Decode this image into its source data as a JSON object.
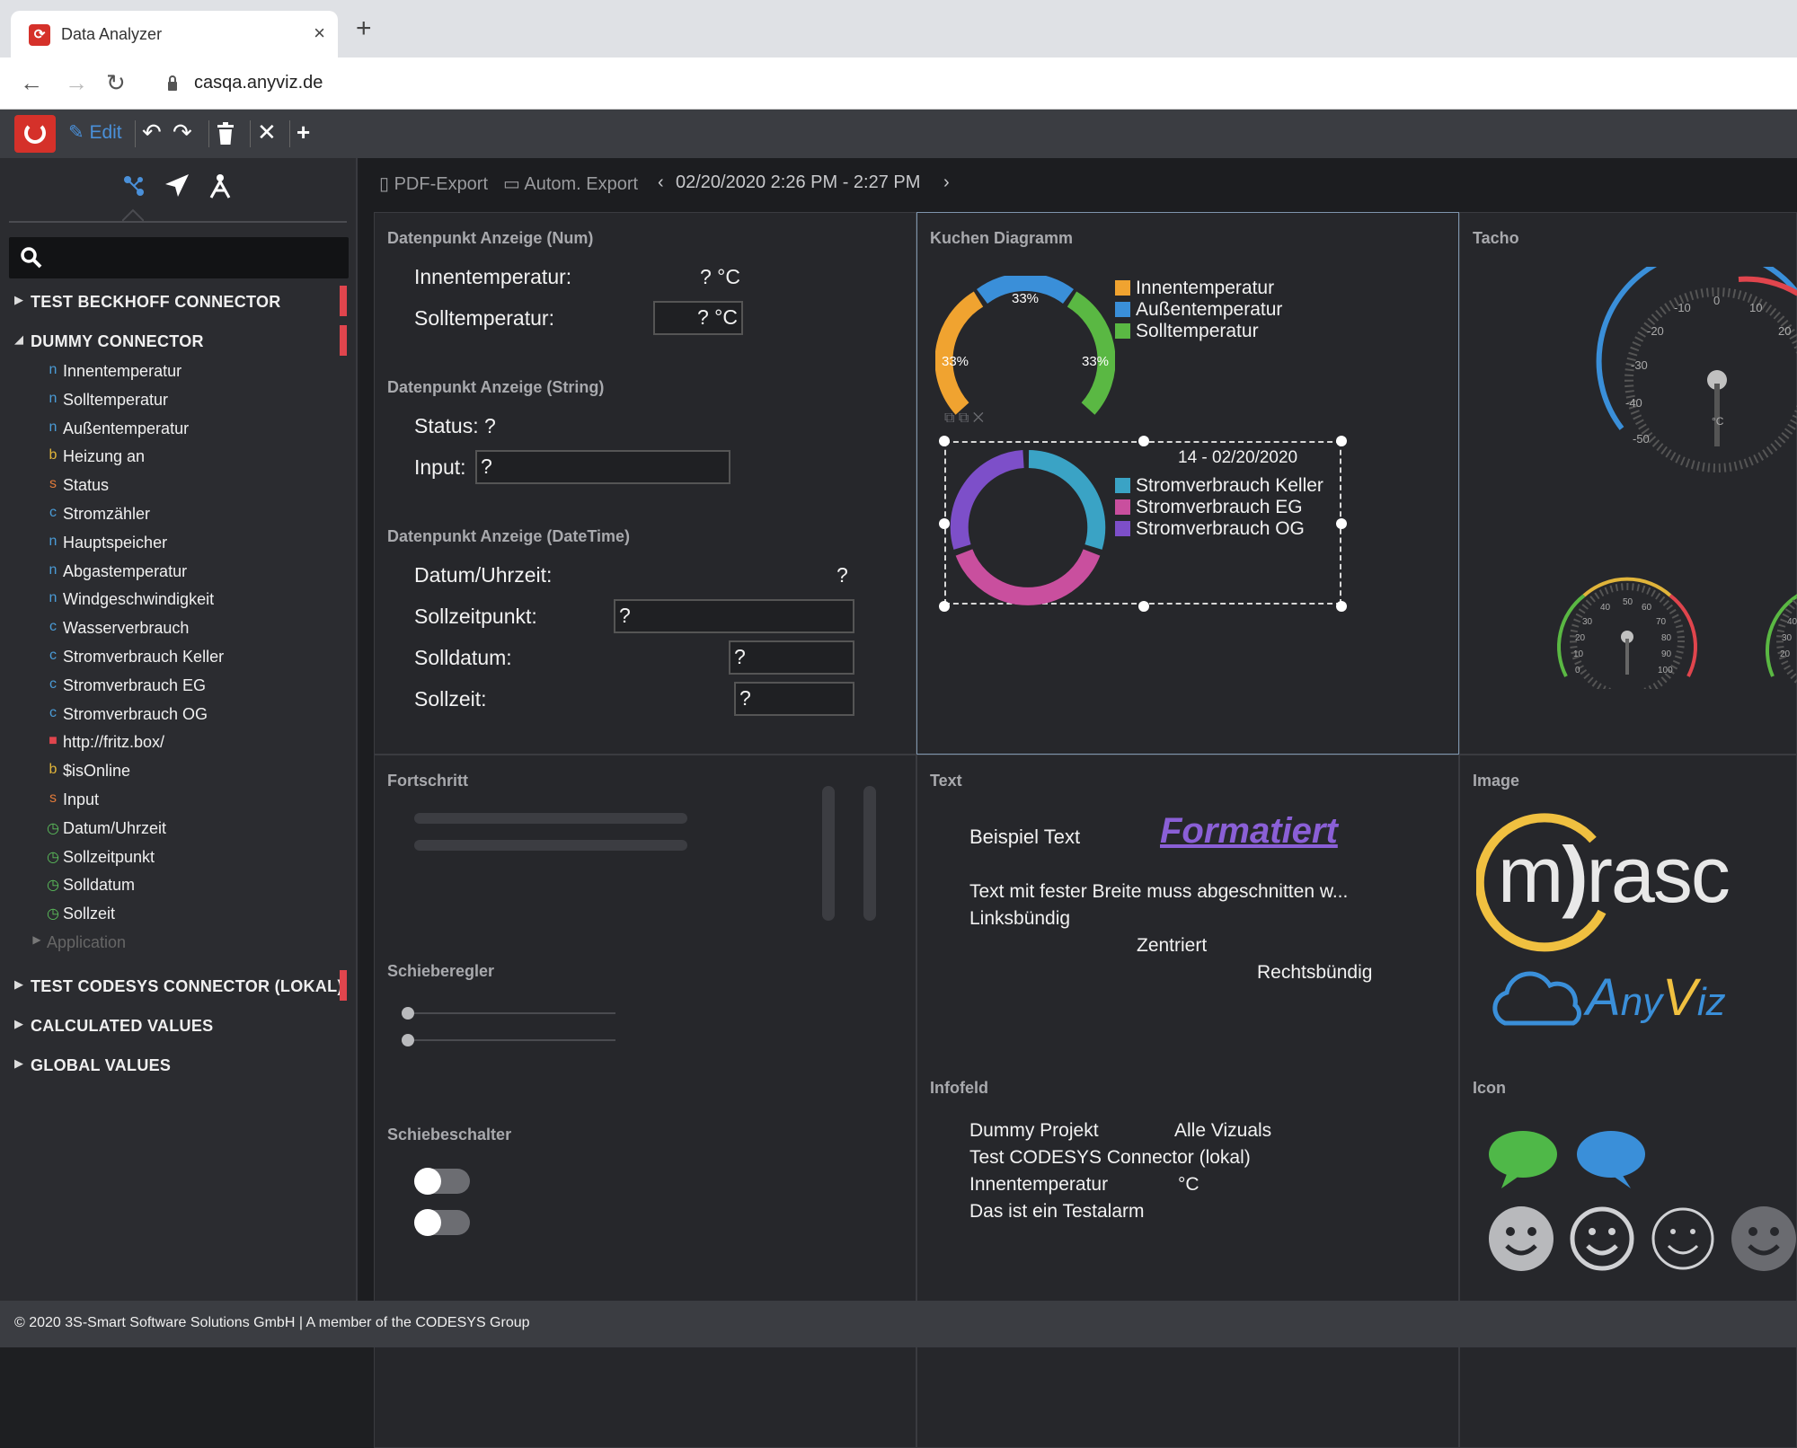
{
  "browser": {
    "tab_title": "Data Analyzer",
    "tab_close": "×",
    "new_tab": "+",
    "url": "casqa.anyviz.de"
  },
  "toolbar": {
    "edit_label": "Edit"
  },
  "sidebar": {
    "tree": [
      {
        "type": "node",
        "label": "TEST BECKHOFF CONNECTOR",
        "flag": true
      },
      {
        "type": "node",
        "label": "DUMMY CONNECTOR",
        "flag": true,
        "expanded": true
      },
      {
        "type": "item",
        "kind": "n",
        "label": "Innentemperatur"
      },
      {
        "type": "item",
        "kind": "n",
        "label": "Solltemperatur"
      },
      {
        "type": "item",
        "kind": "n",
        "label": "Außentemperatur"
      },
      {
        "type": "item",
        "kind": "b",
        "label": "Heizung an"
      },
      {
        "type": "item",
        "kind": "s",
        "label": "Status"
      },
      {
        "type": "item",
        "kind": "c",
        "label": "Stromzähler"
      },
      {
        "type": "item",
        "kind": "n",
        "label": "Hauptspeicher"
      },
      {
        "type": "item",
        "kind": "n",
        "label": "Abgastemperatur"
      },
      {
        "type": "item",
        "kind": "n",
        "label": "Windgeschwindigkeit"
      },
      {
        "type": "item",
        "kind": "c",
        "label": "Wasserverbrauch"
      },
      {
        "type": "item",
        "kind": "c",
        "label": "Stromverbrauch Keller"
      },
      {
        "type": "item",
        "kind": "c",
        "label": "Stromverbrauch EG"
      },
      {
        "type": "item",
        "kind": "c",
        "label": "Stromverbrauch OG"
      },
      {
        "type": "item",
        "kind": "link",
        "label": "http://fritz.box/"
      },
      {
        "type": "item",
        "kind": "b",
        "label": "$isOnline"
      },
      {
        "type": "item",
        "kind": "s",
        "label": "Input"
      },
      {
        "type": "item",
        "kind": "clock",
        "label": "Datum/Uhrzeit"
      },
      {
        "type": "item",
        "kind": "clock",
        "label": "Sollzeitpunkt"
      },
      {
        "type": "item",
        "kind": "clock",
        "label": "Solldatum"
      },
      {
        "type": "item",
        "kind": "clock",
        "label": "Sollzeit"
      },
      {
        "type": "sub",
        "label": "Application"
      },
      {
        "type": "node",
        "label": "TEST CODESYS CONNECTOR (LOKAL)",
        "flag": true
      },
      {
        "type": "node",
        "label": "CALCULATED VALUES",
        "flag": false
      },
      {
        "type": "node",
        "label": "GLOBAL VALUES",
        "flag": false
      }
    ],
    "kind_colors": {
      "n": "#4a9bd6",
      "b": "#e0b43a",
      "s": "#e07a3a",
      "c": "#4a9bd6",
      "clock": "#5cc05c",
      "link": "#e0454d"
    }
  },
  "main": {
    "toolbar": {
      "pdf_export": "PDF-Export",
      "auto_export": "Autom. Export",
      "range": "02/20/2020 2:26 PM - 2:27 PM"
    },
    "num_panel": {
      "title": "Datenpunkt Anzeige (Num)",
      "rows": [
        {
          "label": "Innentemperatur:",
          "value": "? °C"
        },
        {
          "label": "Solltemperatur:",
          "value": "? °C"
        }
      ]
    },
    "string_panel": {
      "title": "Datenpunkt Anzeige (String)",
      "status": "Status: ?",
      "input_label": "Input:",
      "input_value": "?"
    },
    "datetime_panel": {
      "title": "Datenpunkt Anzeige (DateTime)",
      "datum_label": "Datum/Uhrzeit:",
      "datum_value": "?",
      "fields": [
        {
          "label": "Sollzeitpunkt:",
          "value": "?"
        },
        {
          "label": "Solldatum:",
          "value": "?"
        },
        {
          "label": "Sollzeit:",
          "value": "?"
        }
      ]
    },
    "pie_panel": {
      "title": "Kuchen Diagramm",
      "chart1": {
        "labels": [
          "33%",
          "33%",
          "33%"
        ],
        "legend": [
          {
            "name": "Innentemperatur",
            "color": "#f0a330"
          },
          {
            "name": "Außentemperatur",
            "color": "#3a8fd9"
          },
          {
            "name": "Solltemperatur",
            "color": "#5ab843"
          }
        ]
      },
      "chart2": {
        "title": "14 - 02/20/2020",
        "legend": [
          {
            "name": "Stromverbrauch Keller",
            "color": "#3aa3c5"
          },
          {
            "name": "Stromverbrauch EG",
            "color": "#c94f9e"
          },
          {
            "name": "Stromverbrauch OG",
            "color": "#7d4fc9"
          }
        ]
      }
    },
    "tacho_panel": {
      "title": "Tacho",
      "big_ticks": [
        "-50",
        "-40",
        "-30",
        "-20",
        "-10",
        "0",
        "10",
        "20"
      ],
      "unit": "°C",
      "small_ticks": [
        "0",
        "10",
        "20",
        "30",
        "40",
        "50",
        "60",
        "70",
        "80",
        "90",
        "100"
      ],
      "small_ticks_right": [
        "20",
        "30",
        "40"
      ]
    },
    "progress_panel": {
      "title": "Fortschritt",
      "slider_title": "Schieberegler",
      "switch_title": "Schiebeschalter"
    },
    "text_panel": {
      "title": "Text",
      "sample": "Beispiel Text",
      "formatted": "Formatiert",
      "truncated": "Text mit fester Breite muss abgeschnitten w...",
      "left": "Linksbündig",
      "center": "Zentriert",
      "right": "Rechtsbündig",
      "info_title": "Infofeld",
      "info": {
        "project": "Dummy Projekt",
        "vizuals": "Alle Vizuals",
        "connector": "Test CODESYS Connector (lokal)",
        "dp": "Innentemperatur",
        "unit": "°C",
        "alarm": "Das ist ein Testalarm"
      }
    },
    "image_panel": {
      "title": "Image",
      "logo_text": "m",
      "logo_rest": "rasc",
      "anyviz_a": "A",
      "anyviz_ny": "ny",
      "anyviz_v": "V",
      "anyviz_iz": "iz",
      "icon_title": "Icon"
    }
  },
  "footer": {
    "text": "© 2020 3S-Smart Software Solutions GmbH | A member of the CODESYS Group"
  }
}
